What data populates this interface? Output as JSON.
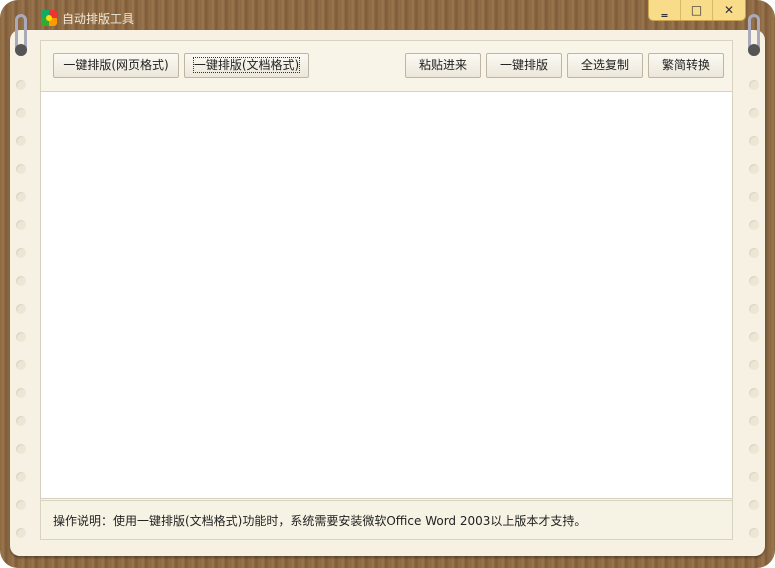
{
  "window": {
    "title": "自动排版工具",
    "minimize": "‗",
    "maximize": "□",
    "close": "✕"
  },
  "toolbar": {
    "format_web": "一键排版(网页格式)",
    "format_doc": "一键排版(文档格式)",
    "paste": "粘贴进来",
    "format": "一键排版",
    "copy_all": "全选复制",
    "convert": "繁简转换"
  },
  "editor": {
    "value": ""
  },
  "status": {
    "text": "操作说明：使用一键排版(文档格式)功能时，系统需要安装微软Office Word 2003以上版本才支持。"
  }
}
